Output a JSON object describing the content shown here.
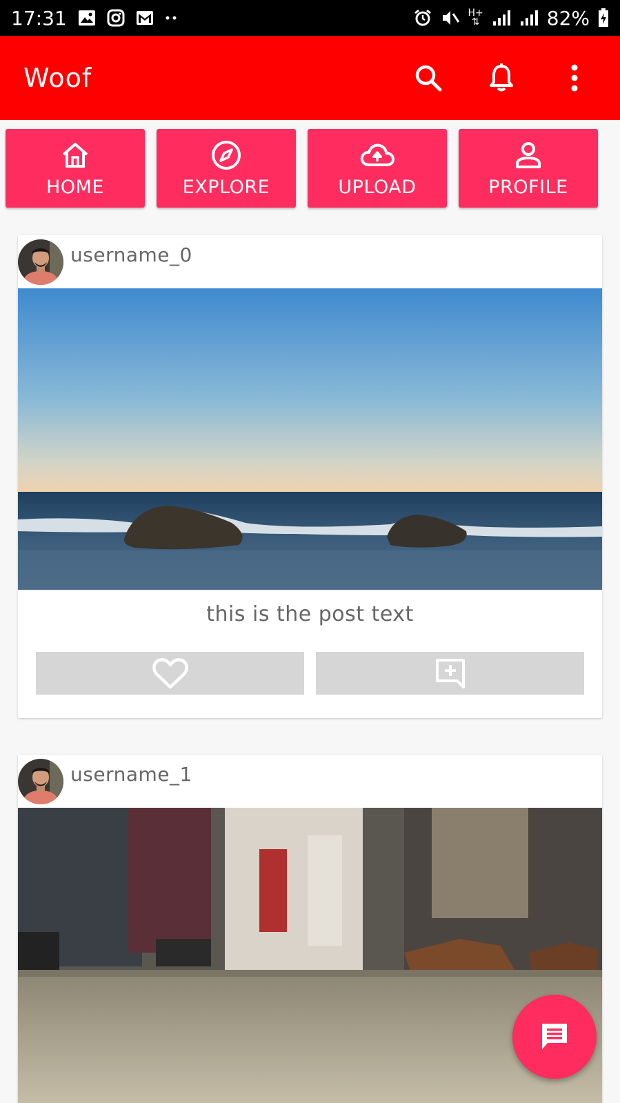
{
  "status_bar": {
    "time": "17:31",
    "battery": "82%",
    "network": "H+"
  },
  "app_bar": {
    "title": "Woof",
    "background": "#ff0000"
  },
  "nav": {
    "accent": "#ff2c5f",
    "tiles": [
      {
        "label": "HOME",
        "icon": "home-icon"
      },
      {
        "label": "EXPLORE",
        "icon": "compass-icon"
      },
      {
        "label": "UPLOAD",
        "icon": "cloud-upload-icon"
      },
      {
        "label": "PROFILE",
        "icon": "person-icon"
      }
    ]
  },
  "posts": [
    {
      "username": "username_0",
      "image": "ocean-waves-rocks-photo",
      "text": "this is the post text",
      "actions": [
        "heart-icon",
        "add-comment-icon"
      ]
    },
    {
      "username": "username_1",
      "image": "bus-floor-feet-photo"
    }
  ],
  "fab": {
    "icon": "message-icon"
  }
}
